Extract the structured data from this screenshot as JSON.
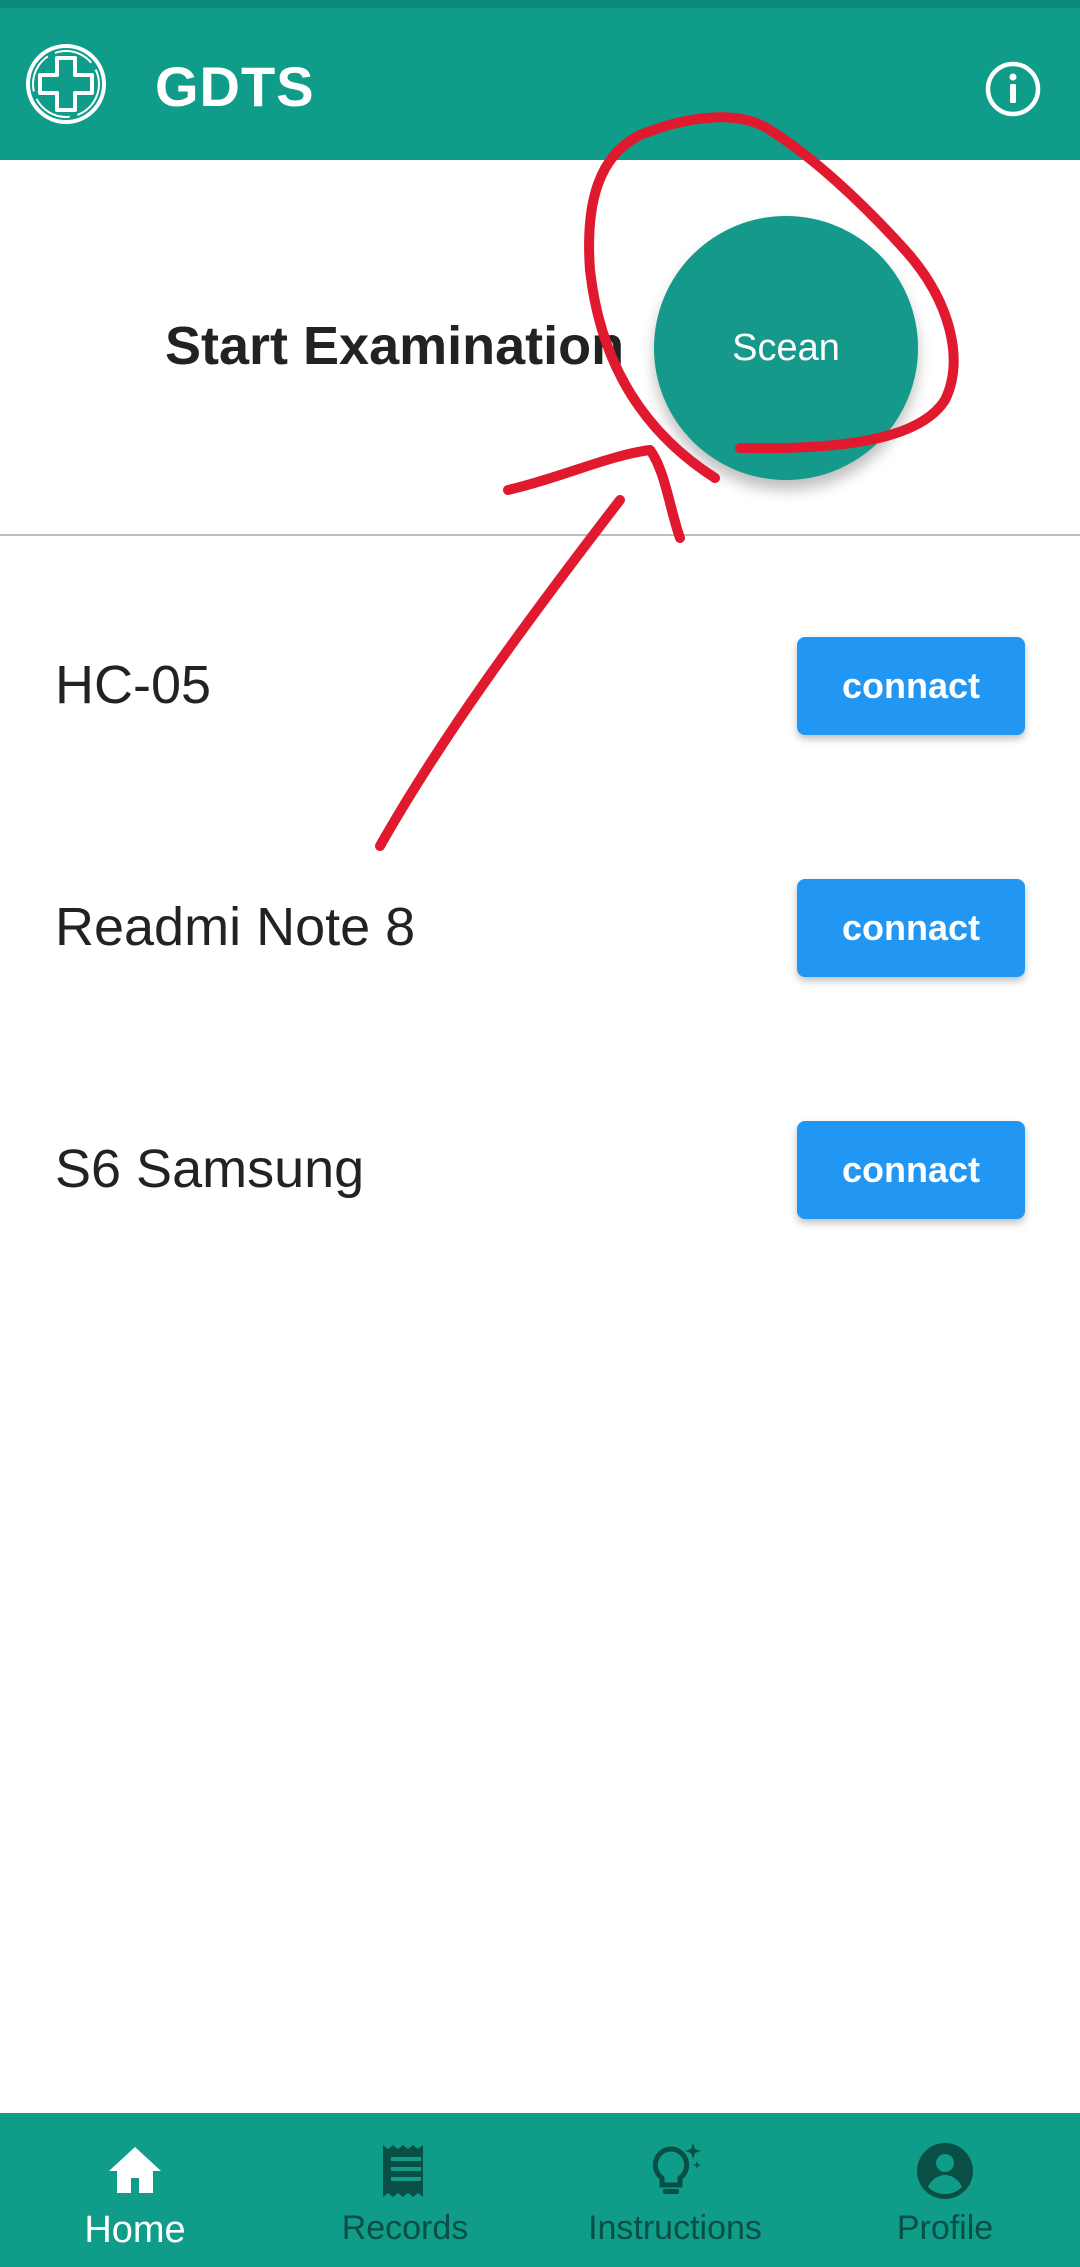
{
  "app": {
    "title": "GDTS"
  },
  "start": {
    "label": "Start Examination",
    "scan_label": "Scean"
  },
  "devices": [
    {
      "name": "HC-05",
      "button_label": "connact"
    },
    {
      "name": "Readmi Note 8",
      "button_label": "connact"
    },
    {
      "name": "S6 Samsung",
      "button_label": "connact"
    }
  ],
  "nav": [
    {
      "label": "Home",
      "icon": "home-icon",
      "active": true
    },
    {
      "label": "Records",
      "icon": "records-icon",
      "active": false
    },
    {
      "label": "Instructions",
      "icon": "lightbulb-icon",
      "active": false
    },
    {
      "label": "Profile",
      "icon": "profile-icon",
      "active": false
    }
  ],
  "colors": {
    "primary": "#0f9d8a",
    "accent_button": "#2196f3",
    "annotation": "#e0192e"
  }
}
